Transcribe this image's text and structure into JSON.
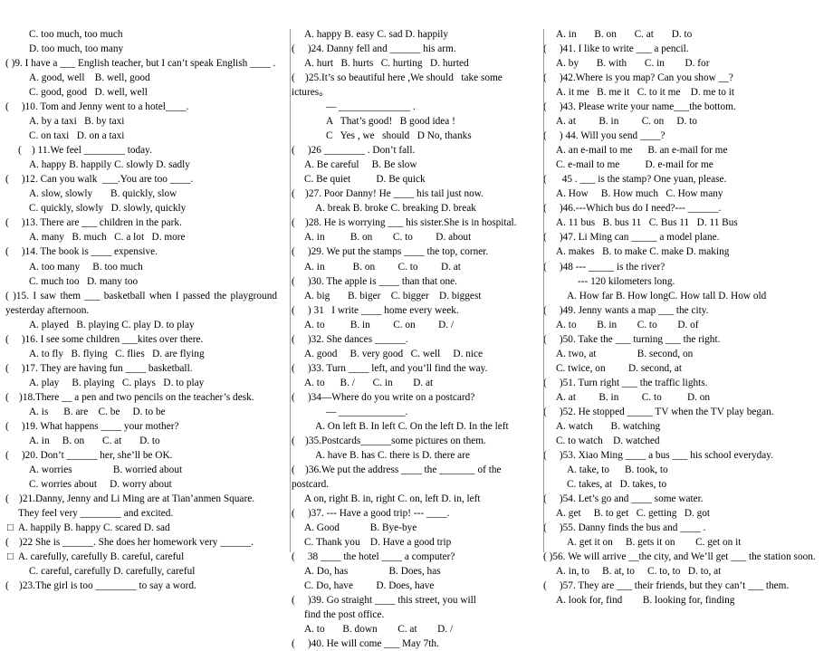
{
  "document": {
    "type": "english-grammar-multiple-choice-worksheet",
    "layout": "three-column",
    "divider_color": "#9a9a9a"
  },
  "column1": {
    "lines": [
      {
        "indent": "indent-1",
        "text": "C. too much, too much"
      },
      {
        "indent": "indent-1",
        "text": "D. too much, too many"
      },
      {
        "indent": "indent-0",
        "justify": true,
        "text": "(     )9.  I  have  a  ___  English  teacher,  but  I  can’t  speak English ____ ."
      },
      {
        "indent": "indent-1",
        "text": "A. good, well    B. well, good"
      },
      {
        "indent": "indent-1",
        "text": "C. good, good   D. well, well"
      },
      {
        "indent": "indent-0",
        "text": "(     )10. Tom and Jenny went to a hotel____."
      },
      {
        "indent": "indent-1",
        "text": "A. by a taxi   B. by taxi"
      },
      {
        "indent": "indent-1",
        "text": "C. on taxi   D. on a taxi"
      },
      {
        "indent": "indent-h",
        "text": "(    ) 11.We feel ________ today."
      },
      {
        "indent": "indent-1",
        "text": "A. happy B. happily C. slowly D. sadly"
      },
      {
        "indent": "indent-0",
        "text": "(     )12. Can you walk  ___.You are too ____."
      },
      {
        "indent": "indent-1",
        "text": "A. slow, slowly       B. quickly, slow"
      },
      {
        "indent": "indent-1",
        "text": "C. quickly, slowly   D. slowly, quickly"
      },
      {
        "indent": "indent-0",
        "text": "(     )13. There are ___ children in the park."
      },
      {
        "indent": "indent-1",
        "text": "A. many   B. much   C. a lot   D. more"
      },
      {
        "indent": "indent-0",
        "text": "(     )14. The book is ____ expensive."
      },
      {
        "indent": "indent-1",
        "text": "A. too many     B. too much"
      },
      {
        "indent": "indent-1",
        "text": "C. much too   D. many too"
      },
      {
        "indent": "indent-0",
        "justify": true,
        "text": "(      )15.  I  saw  them  ___  basketball  when  I  passed  the playground yesterday afternoon."
      },
      {
        "indent": "indent-1",
        "text": "A. played   B. playing C. play D. to play"
      },
      {
        "indent": "indent-0",
        "text": "(     )16. I see some children ___kites over there."
      },
      {
        "indent": "indent-1",
        "text": "A. to fly   B. flying   C. flies   D. are flying"
      },
      {
        "indent": "indent-0",
        "text": "(     )17. They are having fun ____ basketball."
      },
      {
        "indent": "indent-1",
        "text": "A. play     B. playing   C. plays   D. to play"
      },
      {
        "indent": "indent-0",
        "text": "(    )18.There __ a pen and two pencils on the teacher’s desk."
      },
      {
        "indent": "indent-1",
        "text": "A. is      B. are    C. be     D. to be"
      },
      {
        "indent": "indent-0",
        "text": "(     )19. What happens ____ your mother?"
      },
      {
        "indent": "indent-1",
        "text": "A. in     B. on       C. at       D. to"
      },
      {
        "indent": "indent-0",
        "text": "(     )20. Don’t ______ her, she’ll be OK."
      },
      {
        "indent": "indent-1",
        "text": "A. worries                B. worried about"
      },
      {
        "indent": "indent-1",
        "text": "C. worries about     D. worry about"
      },
      {
        "indent": "indent-0",
        "text": "(    )21.Danny, Jenny and Li Ming are at Tian’anmen Square."
      },
      {
        "indent": "indent-h",
        "text": "They feel very ________ and excited."
      },
      {
        "indent": "sq",
        "text": "□  A. happily B. happy C. scared D. sad"
      },
      {
        "indent": "indent-0",
        "text": "(    )22 She is ______. She does her homework very ______."
      },
      {
        "indent": "sq",
        "text": "□  A. carefully, carefully B. careful, careful"
      },
      {
        "indent": "indent-1",
        "text": "C. careful, carefully D. carefully, careful"
      },
      {
        "indent": "indent-0",
        "text": "(    )23.The girl is too ________ to say a word."
      }
    ]
  },
  "column2": {
    "lines": [
      {
        "indent": "indent-h",
        "text": "A. happy B. easy C. sad D. happily"
      },
      {
        "indent": "indent-0",
        "text": "(     )24. Danny fell and ______ his arm."
      },
      {
        "indent": "indent-h",
        "text": "A. hurt   B. hurts   C. hurting   D. hurted"
      },
      {
        "indent": "indent-0",
        "text": "(    )25.It’s so beautiful here ,We should   take some ictures。"
      },
      {
        "indent": "indent-2",
        "text": "— ______________ ."
      },
      {
        "indent": "indent-2",
        "text": "A   That’s good!   B good idea !"
      },
      {
        "indent": "indent-2",
        "text": "C   Yes , we   should   D No, thanks"
      },
      {
        "indent": "indent-0",
        "text": "(     )26 ________ . Don’t fall."
      },
      {
        "indent": "indent-h",
        "text": "A. Be careful     B. Be slow"
      },
      {
        "indent": "indent-h",
        "text": "C. Be quiet          D. Be quick"
      },
      {
        "indent": "indent-0",
        "text": "(    )27. Poor Danny! He ____ his tail just now."
      },
      {
        "indent": "indent-1",
        "text": "A. break B. broke C. breaking D. break"
      },
      {
        "indent": "indent-0",
        "text": "(    )28. He is worrying ___ his sister.She is in hospital."
      },
      {
        "indent": "indent-h",
        "text": "A. in          B. on        C. to         D. about"
      },
      {
        "indent": "indent-0",
        "text": "(     )29. We put the stamps ____ the top, corner."
      },
      {
        "indent": "indent-h",
        "text": "A. in           B. on         C. to         D. at"
      },
      {
        "indent": "indent-0",
        "text": "(     )30. The apple is ____ than that one."
      },
      {
        "indent": "indent-h",
        "text": "A. big       B. biger    C. bigger    D. biggest"
      },
      {
        "indent": "indent-0",
        "text": "(     ) 31   I write ____ home every week."
      },
      {
        "indent": "indent-h",
        "text": "A. to          B. in         C. on         D. /"
      },
      {
        "indent": "indent-0",
        "text": "(     )32. She dances ______."
      },
      {
        "indent": "indent-h",
        "text": "A. good     B. very good   C. well     D. nice"
      },
      {
        "indent": "indent-0",
        "text": "(     )33. Turn ____ left, and you’ll find the way."
      },
      {
        "indent": "indent-h",
        "text": "A. to      B. /       C. in        D. at"
      },
      {
        "indent": "indent-0",
        "text": "(     )34—Where do you write on a postcard?"
      },
      {
        "indent": "indent-2",
        "text": "— _____________."
      },
      {
        "indent": "indent-1",
        "text": "A. On left B. In left C. On the left D. In the left"
      },
      {
        "indent": "indent-0",
        "text": "(    )35.Postcards______some pictures on them."
      },
      {
        "indent": "indent-1",
        "text": "A. have B. has C. there is D. there are"
      },
      {
        "indent": "indent-0",
        "text": "(    )36.We put the address ____ the _______ of the postcard."
      },
      {
        "indent": "indent-h",
        "text": "A on, right B. in, right C. on, left D. in, left"
      },
      {
        "indent": "indent-0",
        "text": "(     )37. --- Have a good trip! --- ____."
      },
      {
        "indent": "indent-h",
        "text": "A. Good            B. Bye-bye"
      },
      {
        "indent": "indent-h",
        "text": "C. Thank you    D. Have a good trip"
      },
      {
        "indent": "indent-0",
        "text": "(     38 ____ the hotel ____ a computer?"
      },
      {
        "indent": "indent-h",
        "text": "A. Do, has                B. Does, has"
      },
      {
        "indent": "indent-h",
        "text": "C. Do, have         D. Does, have"
      },
      {
        "indent": "indent-0",
        "text": "(     )39. Go straight ____ this street, you will"
      },
      {
        "indent": "indent-h",
        "text": "find the post office."
      },
      {
        "indent": "indent-h",
        "text": "A. to       B. down        C. at        D. /"
      },
      {
        "indent": "indent-0",
        "text": "(     )40. He will come ___ May 7th."
      }
    ]
  },
  "column3": {
    "lines": [
      {
        "indent": "indent-h",
        "text": "A. in       B. on       C. at       D. to"
      },
      {
        "indent": "indent-0",
        "text": "(     )41. I like to write ___ a pencil."
      },
      {
        "indent": "indent-h",
        "text": "A. by       B. with       C. in        D. for"
      },
      {
        "indent": "indent-0",
        "text": "(     )42.Where is you map? Can you show __?"
      },
      {
        "indent": "indent-h",
        "text": "A. it me   B. me it   C. to it me    D. me to it"
      },
      {
        "indent": "indent-0",
        "text": "(     )43. Please write your name___the bottom."
      },
      {
        "indent": "indent-h",
        "text": "A. at         B. in         C. on     D. to"
      },
      {
        "indent": "indent-0",
        "text": "(     ) 44. Will you send ____?"
      },
      {
        "indent": "indent-h",
        "text": "A. an e-mail to me      B. an e-mail for me"
      },
      {
        "indent": "indent-h",
        "text": "C. e-mail to me          D. e-mail for me"
      },
      {
        "indent": "indent-0",
        "text": "(      45 . ___ is the stamp? One yuan, please."
      },
      {
        "indent": "indent-h",
        "text": "A. How     B. How much   C. How many"
      },
      {
        "indent": "indent-0",
        "text": "(     )46.---Which bus do I need?--- ______."
      },
      {
        "indent": "indent-h",
        "text": "A. 11 bus   B. bus 11   C. Bus 11   D. 11 Bus"
      },
      {
        "indent": "indent-0",
        "text": "(     )47. Li Ming can _____ a model plane."
      },
      {
        "indent": "indent-h",
        "text": "A. makes   B. to make C. make D. making"
      },
      {
        "indent": "indent-0",
        "text": "(     )48 --- _____ is the river?"
      },
      {
        "indent": "indent-2",
        "text": "--- 120 kilometers long."
      },
      {
        "indent": "indent-1",
        "text": "A. How far B. How longC. How tall D. How old"
      },
      {
        "indent": "indent-0",
        "text": "(     )49. Jenny wants a map ___ the city."
      },
      {
        "indent": "indent-h",
        "text": "A. to        B. in        C. to        D. of"
      },
      {
        "indent": "indent-0",
        "text": "(     )50. Take the ___ turning ___ the right."
      },
      {
        "indent": "indent-h",
        "text": "A. two, at                B. second, on"
      },
      {
        "indent": "indent-h",
        "text": "C. twice, on         D. second, at"
      },
      {
        "indent": "indent-0",
        "text": "(     )51. Turn right ___ the traffic lights."
      },
      {
        "indent": "indent-h",
        "text": "A. at         B. in         C. to          D. on"
      },
      {
        "indent": "indent-0",
        "text": "(     )52. He stopped _____ TV when the TV play began."
      },
      {
        "indent": "indent-h",
        "text": "A. watch       B. watching"
      },
      {
        "indent": "indent-h",
        "text": "C. to watch    D. watched"
      },
      {
        "indent": "indent-0",
        "text": "(     )53. Xiao Ming ____ a bus ___ his school everyday."
      },
      {
        "indent": "indent-1",
        "text": "A. take, to      B. took, to"
      },
      {
        "indent": "indent-1",
        "text": "C. takes, at   D. takes, to"
      },
      {
        "indent": "indent-0",
        "text": "(     )54. Let’s go and ____ some water."
      },
      {
        "indent": "indent-h",
        "text": "A. get     B. to get   C. getting   D. got"
      },
      {
        "indent": "indent-0",
        "text": "(     )55. Danny finds the bus and ____ ."
      },
      {
        "indent": "indent-1",
        "text": "A. get it on     B. gets it on        C. get on it"
      },
      {
        "indent": "indent-0",
        "justify": true,
        "text": "(      )56.  We  will  arrive  __the  city,  and  We’ll  get  ___  the station soon."
      },
      {
        "indent": "indent-h",
        "text": "A. in, to     B. at, to     C. to, to   D. to, at"
      },
      {
        "indent": "indent-0",
        "text": "(     )57. They are ___ their friends, but they can’t ___ them."
      },
      {
        "indent": "indent-h",
        "text": "A. look for, find        B. looking for, finding"
      }
    ]
  }
}
